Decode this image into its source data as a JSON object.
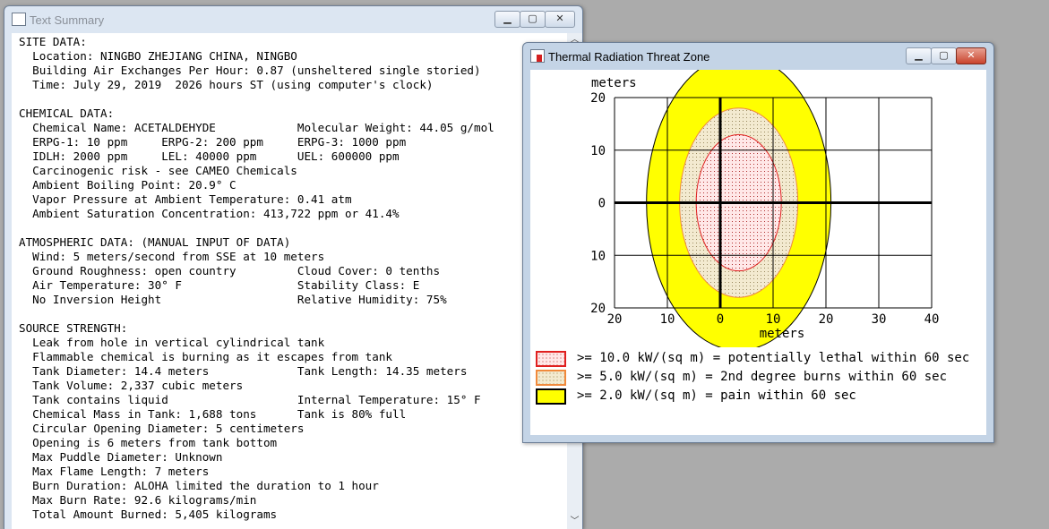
{
  "summary_window": {
    "title": "Text Summary",
    "lines": [
      "SITE DATA:",
      "  Location: NINGBO ZHEJIANG CHINA, NINGBO",
      "  Building Air Exchanges Per Hour: 0.87 (unsheltered single storied)",
      "  Time: July 29, 2019  2026 hours ST (using computer's clock)",
      "",
      "CHEMICAL DATA:",
      "  Chemical Name: ACETALDEHYDE            Molecular Weight: 44.05 g/mol",
      "  ERPG-1: 10 ppm     ERPG-2: 200 ppm     ERPG-3: 1000 ppm",
      "  IDLH: 2000 ppm     LEL: 40000 ppm      UEL: 600000 ppm",
      "  Carcinogenic risk - see CAMEO Chemicals",
      "  Ambient Boiling Point: 20.9° C",
      "  Vapor Pressure at Ambient Temperature: 0.41 atm",
      "  Ambient Saturation Concentration: 413,722 ppm or 41.4%",
      "",
      "ATMOSPHERIC DATA: (MANUAL INPUT OF DATA)",
      "  Wind: 5 meters/second from SSE at 10 meters",
      "  Ground Roughness: open country         Cloud Cover: 0 tenths",
      "  Air Temperature: 30° F                 Stability Class: E",
      "  No Inversion Height                    Relative Humidity: 75%",
      "",
      "SOURCE STRENGTH:",
      "  Leak from hole in vertical cylindrical tank",
      "  Flammable chemical is burning as it escapes from tank",
      "  Tank Diameter: 14.4 meters             Tank Length: 14.35 meters",
      "  Tank Volume: 2,337 cubic meters",
      "  Tank contains liquid                   Internal Temperature: 15° F",
      "  Chemical Mass in Tank: 1,688 tons      Tank is 80% full",
      "  Circular Opening Diameter: 5 centimeters",
      "  Opening is 6 meters from tank bottom",
      "  Max Puddle Diameter: Unknown",
      "  Max Flame Length: 7 meters",
      "  Burn Duration: ALOHA limited the duration to 1 hour",
      "  Max Burn Rate: 92.6 kilograms/min",
      "  Total Amount Burned: 5,405 kilograms"
    ]
  },
  "threat_window": {
    "title": "Thermal Radiation Threat Zone"
  },
  "chart_data": {
    "type": "map",
    "ylabel": "meters",
    "xlabel": "meters",
    "x_ticks": [
      "20",
      "10",
      "0",
      "10",
      "20",
      "30",
      "40"
    ],
    "x_tick_values": [
      -20,
      -10,
      0,
      10,
      20,
      30,
      40
    ],
    "y_ticks": [
      "20",
      "10",
      "0",
      "10",
      "20"
    ],
    "y_tick_values": [
      20,
      10,
      0,
      -10,
      -20
    ],
    "xlim": [
      -20,
      40
    ],
    "ylim": [
      -20,
      20
    ],
    "grid": true,
    "zones": [
      {
        "label": ">= 10.0 kW/(sq m) = potentially lethal within 60 sec",
        "radius": 9,
        "center_x": 3.5,
        "center_y": 0,
        "fill": "#ffe8e8",
        "stroke": "#e02020",
        "pattern": "dots"
      },
      {
        "label": ">= 5.0 kW/(sq m) = 2nd degree burns within 60 sec",
        "radius": 12.5,
        "center_x": 3.5,
        "center_y": 0,
        "fill": "#f3ead0",
        "stroke": "#f08a3c",
        "pattern": "dots"
      },
      {
        "label": ">= 2.0 kW/(sq m) = pain within 60 sec",
        "radius": 19.5,
        "center_x": 3.5,
        "center_y": 0,
        "fill": "#ffff00",
        "stroke": "#000000",
        "pattern": "solid"
      }
    ]
  }
}
